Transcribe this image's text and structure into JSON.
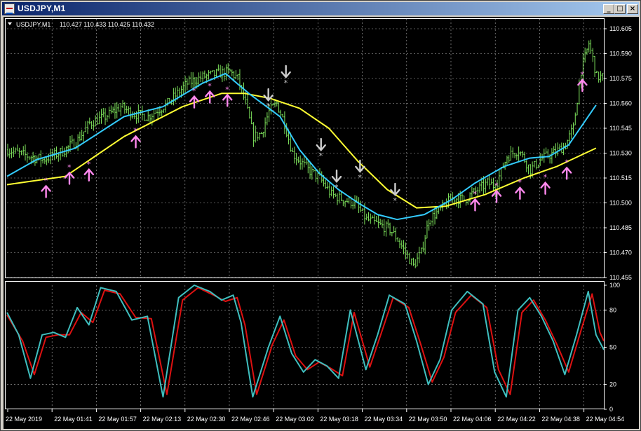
{
  "window": {
    "title": "USDJPY,M1",
    "buttons": {
      "minimize": "_",
      "maximize": "□",
      "close": "×"
    }
  },
  "chart_header": {
    "symbol_info": "USDJPY,M1",
    "ohlc": "110.427 110.433 110.425 110.432"
  },
  "colors": {
    "background": "#000000",
    "grid": "#b0b0b0",
    "candle": "#7ee35c",
    "ma_fast": "#33ccff",
    "ma_slow": "#ffff33",
    "stoch_main": "#3fbfbf",
    "stoch_signal": "#dd1111",
    "buy_arrow": "#ff88ee",
    "sell_arrow": "#cccccc"
  },
  "chart_data": [
    {
      "type": "candlestick",
      "yticks": [
        "110.605",
        "110.590",
        "110.575",
        "110.560",
        "110.545",
        "110.530",
        "110.515",
        "110.500",
        "110.485",
        "110.470",
        "110.455"
      ],
      "ylim": [
        110.455,
        110.605
      ],
      "xticks": [
        "22 May 2019",
        "22 May 01:41",
        "22 May 01:57",
        "22 May 02:13",
        "22 May 02:30",
        "22 May 02:46",
        "22 May 03:02",
        "22 May 03:18",
        "22 May 03:34",
        "22 May 03:50",
        "22 May 04:06",
        "22 May 04:22",
        "22 May 04:38",
        "22 May 04:54"
      ],
      "price_path": [
        [
          0,
          110.532
        ],
        [
          8,
          110.529
        ],
        [
          18,
          110.526
        ],
        [
          28,
          110.531
        ],
        [
          36,
          110.538
        ],
        [
          42,
          110.548
        ],
        [
          50,
          110.552
        ],
        [
          58,
          110.558
        ],
        [
          64,
          110.554
        ],
        [
          72,
          110.552
        ],
        [
          82,
          110.56
        ],
        [
          92,
          110.572
        ],
        [
          100,
          110.576
        ],
        [
          108,
          110.578
        ],
        [
          114,
          110.579
        ],
        [
          118,
          110.575
        ],
        [
          122,
          110.56
        ],
        [
          126,
          110.54
        ],
        [
          130,
          110.542
        ],
        [
          134,
          110.555
        ],
        [
          138,
          110.56
        ],
        [
          142,
          110.548
        ],
        [
          146,
          110.53
        ],
        [
          150,
          110.525
        ],
        [
          154,
          110.52
        ],
        [
          160,
          110.515
        ],
        [
          166,
          110.505
        ],
        [
          172,
          110.502
        ],
        [
          178,
          110.5
        ],
        [
          184,
          110.49
        ],
        [
          190,
          110.487
        ],
        [
          196,
          110.484
        ],
        [
          200,
          110.478
        ],
        [
          204,
          110.47
        ],
        [
          208,
          110.462
        ],
        [
          212,
          110.47
        ],
        [
          216,
          110.49
        ],
        [
          222,
          110.496
        ],
        [
          228,
          110.503
        ],
        [
          234,
          110.502
        ],
        [
          240,
          110.507
        ],
        [
          246,
          110.512
        ],
        [
          250,
          110.51
        ],
        [
          256,
          110.528
        ],
        [
          262,
          110.532
        ],
        [
          268,
          110.52
        ],
        [
          274,
          110.527
        ],
        [
          280,
          110.53
        ],
        [
          286,
          110.535
        ],
        [
          290,
          110.545
        ],
        [
          294,
          110.58
        ],
        [
          298,
          110.596
        ],
        [
          300,
          110.587
        ],
        [
          302,
          110.576
        ]
      ],
      "ma_fast_points": [
        [
          0,
          110.516
        ],
        [
          15,
          110.526
        ],
        [
          35,
          110.533
        ],
        [
          60,
          110.552
        ],
        [
          80,
          110.558
        ],
        [
          100,
          110.572
        ],
        [
          112,
          110.578
        ],
        [
          124,
          110.566
        ],
        [
          140,
          110.552
        ],
        [
          150,
          110.532
        ],
        [
          160,
          110.518
        ],
        [
          170,
          110.508
        ],
        [
          180,
          110.5
        ],
        [
          190,
          110.493
        ],
        [
          200,
          110.49
        ],
        [
          214,
          110.493
        ],
        [
          228,
          110.502
        ],
        [
          240,
          110.512
        ],
        [
          255,
          110.522
        ],
        [
          268,
          110.527
        ],
        [
          278,
          110.528
        ],
        [
          288,
          110.535
        ],
        [
          302,
          110.559
        ]
      ],
      "ma_slow_points": [
        [
          0,
          110.511
        ],
        [
          30,
          110.516
        ],
        [
          60,
          110.54
        ],
        [
          90,
          110.558
        ],
        [
          110,
          110.566
        ],
        [
          122,
          110.566
        ],
        [
          135,
          110.563
        ],
        [
          150,
          110.557
        ],
        [
          165,
          110.545
        ],
        [
          180,
          110.525
        ],
        [
          195,
          110.508
        ],
        [
          210,
          110.497
        ],
        [
          225,
          110.498
        ],
        [
          245,
          110.505
        ],
        [
          265,
          110.515
        ],
        [
          282,
          110.522
        ],
        [
          302,
          110.533
        ]
      ],
      "buy_signals": [
        {
          "bar": 20,
          "price": 110.511
        },
        {
          "bar": 32,
          "price": 110.519
        },
        {
          "bar": 42,
          "price": 110.521
        },
        {
          "bar": 66,
          "price": 110.541
        },
        {
          "bar": 96,
          "price": 110.565
        },
        {
          "bar": 104,
          "price": 110.568
        },
        {
          "bar": 113,
          "price": 110.566
        },
        {
          "bar": 240,
          "price": 110.503
        },
        {
          "bar": 251,
          "price": 110.508
        },
        {
          "bar": 263,
          "price": 110.51
        },
        {
          "bar": 276,
          "price": 110.513
        },
        {
          "bar": 287,
          "price": 110.522
        },
        {
          "bar": 295,
          "price": 110.575
        }
      ],
      "sell_signals": [
        {
          "bar": 134,
          "price": 110.561
        },
        {
          "bar": 143,
          "price": 110.575
        },
        {
          "bar": 161,
          "price": 110.531
        },
        {
          "bar": 169,
          "price": 110.512
        },
        {
          "bar": 181,
          "price": 110.518
        },
        {
          "bar": 199,
          "price": 110.504
        }
      ]
    },
    {
      "type": "line",
      "yticks": [
        "100",
        "80",
        "50",
        "20",
        "0"
      ],
      "ylim": [
        0,
        100
      ],
      "series": [
        {
          "values": [
            [
              0,
              78
            ],
            [
              6,
              60
            ],
            [
              12,
              25
            ],
            [
              18,
              60
            ],
            [
              24,
              62
            ],
            [
              30,
              58
            ],
            [
              36,
              82
            ],
            [
              42,
              68
            ],
            [
              48,
              98
            ],
            [
              56,
              95
            ],
            [
              64,
              72
            ],
            [
              72,
              75
            ],
            [
              80,
              10
            ],
            [
              88,
              90
            ],
            [
              96,
              100
            ],
            [
              104,
              95
            ],
            [
              110,
              88
            ],
            [
              116,
              92
            ],
            [
              120,
              70
            ],
            [
              126,
              10
            ],
            [
              134,
              50
            ],
            [
              140,
              75
            ],
            [
              146,
              45
            ],
            [
              152,
              30
            ],
            [
              158,
              40
            ],
            [
              164,
              35
            ],
            [
              170,
              25
            ],
            [
              176,
              80
            ],
            [
              184,
              32
            ],
            [
              190,
              60
            ],
            [
              196,
              92
            ],
            [
              204,
              85
            ],
            [
              210,
              55
            ],
            [
              216,
              20
            ],
            [
              222,
              40
            ],
            [
              228,
              80
            ],
            [
              236,
              95
            ],
            [
              244,
              85
            ],
            [
              250,
              30
            ],
            [
              256,
              10
            ],
            [
              262,
              80
            ],
            [
              268,
              90
            ],
            [
              274,
              75
            ],
            [
              280,
              55
            ],
            [
              286,
              28
            ],
            [
              292,
              60
            ],
            [
              298,
              95
            ],
            [
              302,
              60
            ],
            [
              306,
              48
            ]
          ]
        },
        {
          "values": [
            [
              0,
              76
            ],
            [
              8,
              55
            ],
            [
              14,
              28
            ],
            [
              20,
              58
            ],
            [
              26,
              60
            ],
            [
              32,
              60
            ],
            [
              38,
              78
            ],
            [
              44,
              70
            ],
            [
              50,
              96
            ],
            [
              58,
              93
            ],
            [
              66,
              74
            ],
            [
              74,
              73
            ],
            [
              82,
              12
            ],
            [
              90,
              88
            ],
            [
              98,
              98
            ],
            [
              106,
              92
            ],
            [
              112,
              87
            ],
            [
              118,
              90
            ],
            [
              122,
              68
            ],
            [
              128,
              12
            ],
            [
              136,
              52
            ],
            [
              142,
              72
            ],
            [
              148,
              43
            ],
            [
              154,
              32
            ],
            [
              160,
              38
            ],
            [
              166,
              33
            ],
            [
              172,
              27
            ],
            [
              178,
              78
            ],
            [
              186,
              34
            ],
            [
              192,
              62
            ],
            [
              198,
              90
            ],
            [
              206,
              82
            ],
            [
              212,
              53
            ],
            [
              218,
              22
            ],
            [
              224,
              42
            ],
            [
              230,
              78
            ],
            [
              238,
              92
            ],
            [
              246,
              82
            ],
            [
              252,
              32
            ],
            [
              258,
              12
            ],
            [
              264,
              78
            ],
            [
              270,
              88
            ],
            [
              276,
              72
            ],
            [
              282,
              52
            ],
            [
              288,
              30
            ],
            [
              294,
              62
            ],
            [
              300,
              93
            ],
            [
              304,
              62
            ],
            [
              306,
              55
            ]
          ]
        }
      ]
    }
  ]
}
